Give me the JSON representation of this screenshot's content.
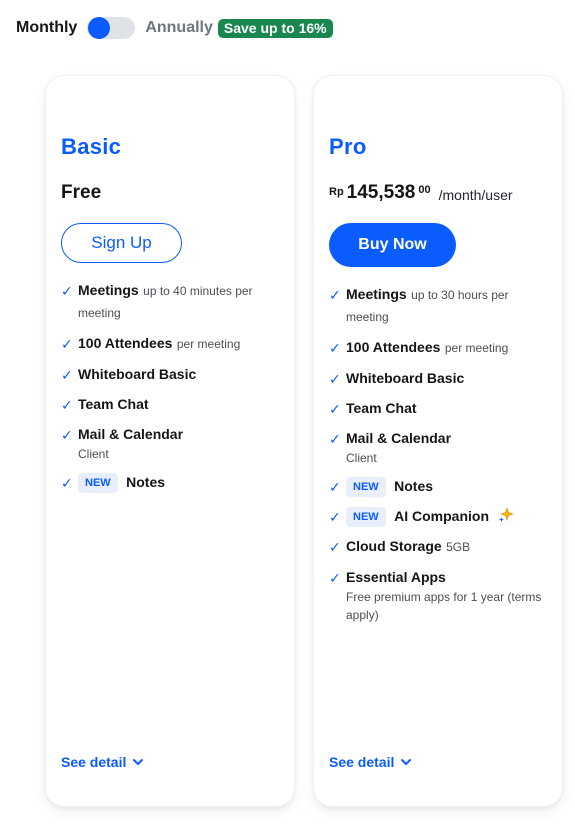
{
  "billing": {
    "monthly_label": "Monthly",
    "annually_label": "Annually",
    "save_badge": "Save up to 16%"
  },
  "plans": [
    {
      "name": "Basic",
      "price_label": "Free",
      "button_label": "Sign Up",
      "features": [
        {
          "name": "Meetings",
          "desc": "up to 40 minutes per meeting"
        },
        {
          "name": "100 Attendees",
          "desc": "per meeting"
        },
        {
          "name": "Whiteboard Basic"
        },
        {
          "name": "Team Chat"
        },
        {
          "name": "Mail & Calendar",
          "sub": "Client"
        },
        {
          "name": "Notes",
          "badge": "NEW"
        }
      ],
      "see_detail": "See detail"
    },
    {
      "name": "Pro",
      "price": {
        "currency": "Rp",
        "amount": "145,538",
        "decimal": "00",
        "period": "/month/user"
      },
      "button_label": "Buy Now",
      "features": [
        {
          "name": "Meetings",
          "desc": "up to 30 hours per meeting"
        },
        {
          "name": "100 Attendees",
          "desc": "per meeting"
        },
        {
          "name": "Whiteboard Basic"
        },
        {
          "name": "Team Chat"
        },
        {
          "name": "Mail & Calendar",
          "sub": "Client"
        },
        {
          "name": "Notes",
          "badge": "NEW"
        },
        {
          "name": "AI Companion",
          "badge": "NEW",
          "icon": "sparkle-icon"
        },
        {
          "name": "Cloud Storage",
          "desc": "5GB"
        },
        {
          "name": "Essential Apps",
          "sub": "Free premium apps for 1 year (terms apply)"
        }
      ],
      "see_detail": "See detail"
    }
  ],
  "colors": {
    "accent": "#0b5cff",
    "save_badge": "#1a8751",
    "toggle_track": "#dfe3e8"
  }
}
